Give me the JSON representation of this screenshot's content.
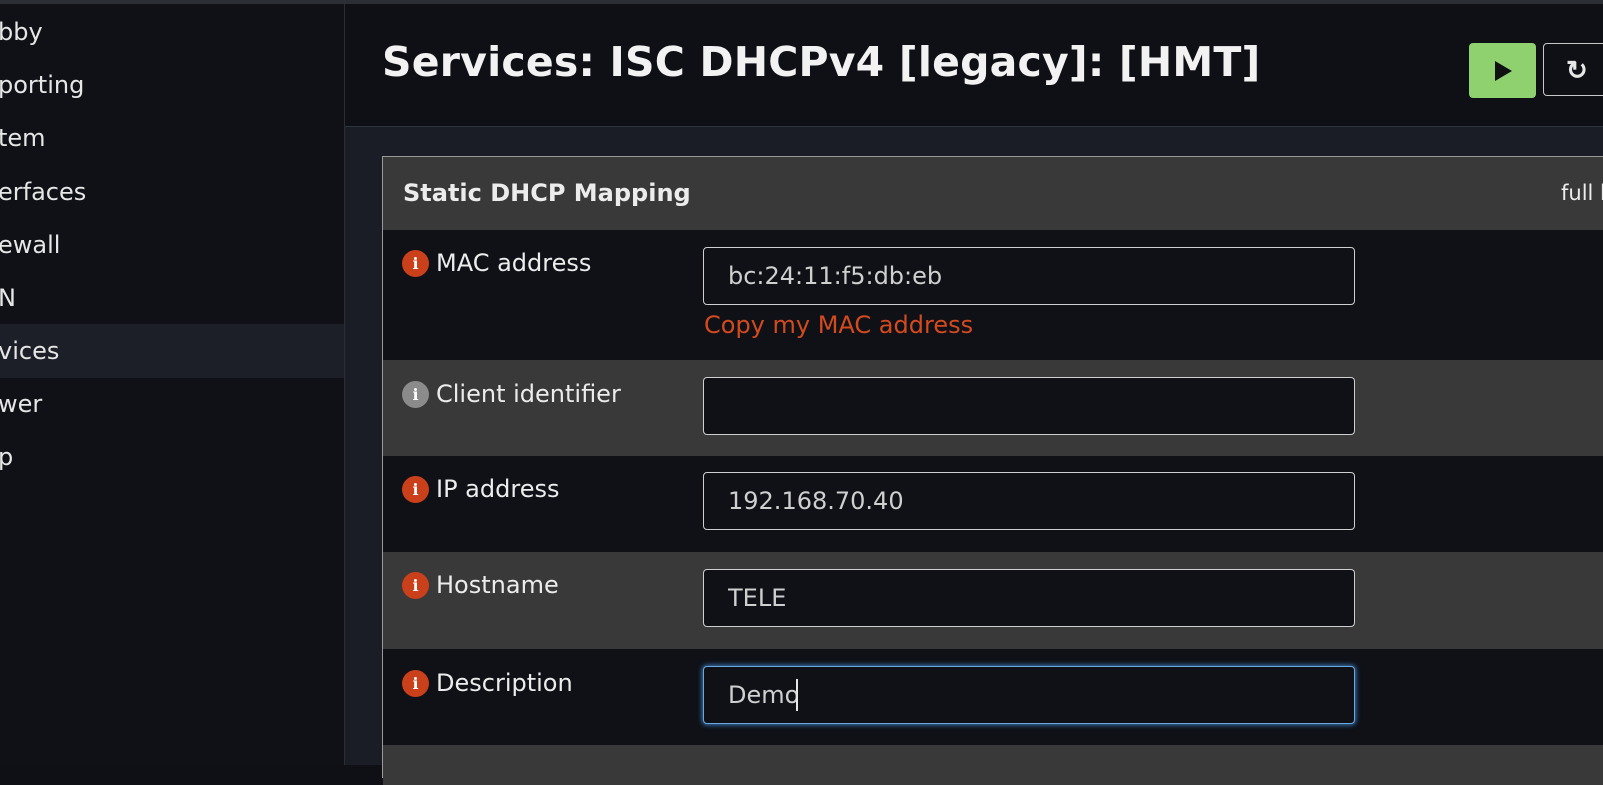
{
  "sidebar": {
    "items": [
      {
        "label": "bby",
        "active": false
      },
      {
        "label": "porting",
        "active": false
      },
      {
        "label": "tem",
        "active": false
      },
      {
        "label": "erfaces",
        "active": false
      },
      {
        "label": "ewall",
        "active": false
      },
      {
        "label": "N",
        "active": false
      },
      {
        "label": "vices",
        "active": true
      },
      {
        "label": "wer",
        "active": false
      },
      {
        "label": "p",
        "active": false
      }
    ]
  },
  "header": {
    "title": "Services: ISC DHCPv4 [legacy]: [HMT]",
    "apply_icon": "play-icon",
    "reload_icon": "reload-icon"
  },
  "panel": {
    "title": "Static DHCP Mapping",
    "help_toggle": "full h",
    "fields": {
      "mac": {
        "label": "MAC address",
        "value": "bc:24:11:f5:db:eb",
        "link": "Copy my MAC address"
      },
      "client_id": {
        "label": "Client identifier",
        "value": ""
      },
      "ip": {
        "label": "IP address",
        "value": "192.168.70.40"
      },
      "hostname": {
        "label": "Hostname",
        "value": "TELE"
      },
      "description": {
        "label": "Description",
        "value": "Demo"
      }
    }
  },
  "colors": {
    "apply_button": "#8fd16f",
    "info_icon": "#c9401a",
    "info_icon_inactive": "#8b8b8b",
    "link": "#d24a1e",
    "focus": "#6aa8e0"
  }
}
